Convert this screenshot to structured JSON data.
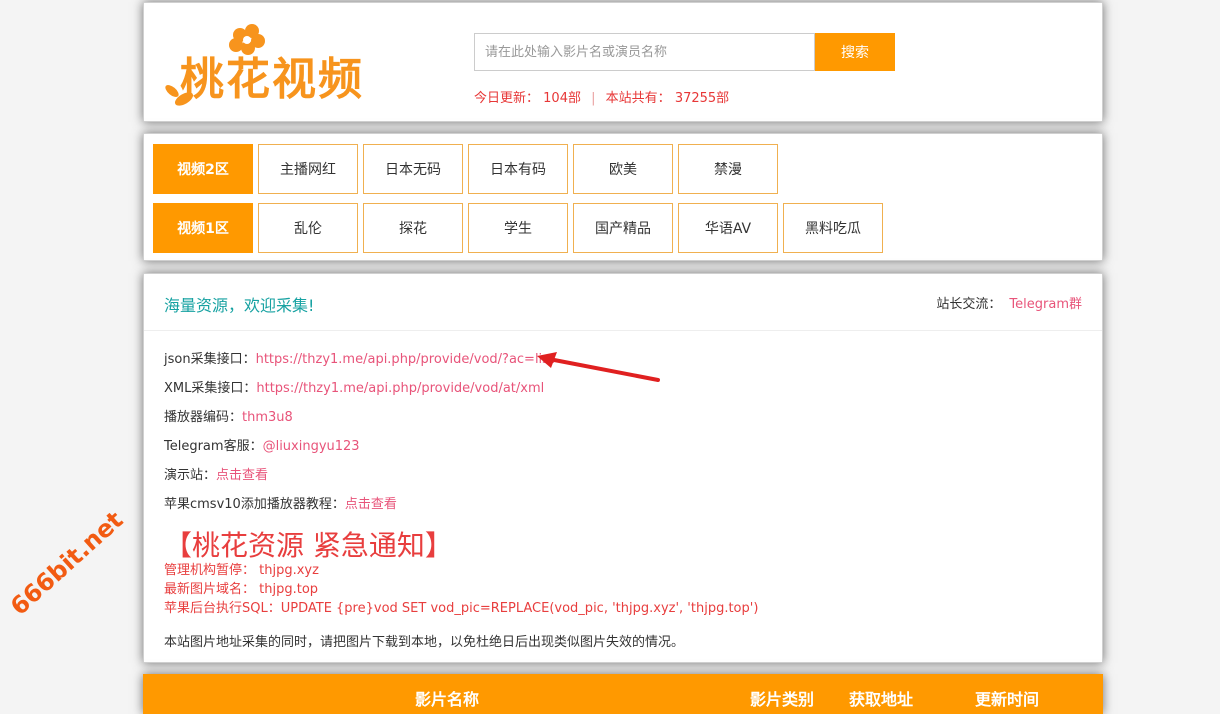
{
  "header": {
    "logo_text": "桃花视频",
    "search_placeholder": "请在此处输入影片名或演员名称",
    "search_button": "搜索",
    "today_label": "今日更新：",
    "today_value": "104部",
    "total_label": "本站共有：",
    "total_value": "37255部"
  },
  "nav": {
    "row1": {
      "head": "视频2区",
      "items": [
        "主播网红",
        "日本无码",
        "日本有码",
        "欧美",
        "禁漫"
      ]
    },
    "row2": {
      "head": "视频1区",
      "items": [
        "乱伦",
        "探花",
        "学生",
        "国产精品",
        "华语AV",
        "黑料吃瓜"
      ]
    }
  },
  "info": {
    "welcome": "海量资源，欢迎采集!",
    "contact_label": "站长交流：",
    "contact_link": "Telegram群",
    "json_label": "json采集接口：",
    "json_url": "https://thzy1.me/api.php/provide/vod/?ac=list",
    "xml_label": "XML采集接口：",
    "xml_url": "https://thzy1.me/api.php/provide/vod/at/xml",
    "player_label": "播放器编码：",
    "player_code": "thm3u8",
    "tg_label": "Telegram客服：",
    "tg_value": "@liuxingyu123",
    "demo_label": "演示站：",
    "demo_link": "点击查看",
    "tutorial_label": "苹果cmsv10添加播放器教程：",
    "tutorial_link": "点击查看",
    "notice_title": "【桃花资源 紧急通知】",
    "notice_lines": [
      "管理机构暂停：  thjpg.xyz",
      "最新图片域名：  thjpg.top",
      "苹果后台执行SQL：UPDATE {pre}vod SET vod_pic=REPLACE(vod_pic, 'thjpg.xyz', 'thjpg.top')"
    ],
    "footer_note": "本站图片地址采集的同时，请把图片下载到本地，以免杜绝日后出现类似图片失效的情况。"
  },
  "table": {
    "headers": [
      "影片名称",
      "影片类别",
      "获取地址",
      "更新时间"
    ]
  },
  "watermark": "666bit.net",
  "colors": {
    "accent": "#ff9900",
    "link": "#e8547a",
    "alert": "#e83e3e",
    "teal": "#17a2a2"
  }
}
